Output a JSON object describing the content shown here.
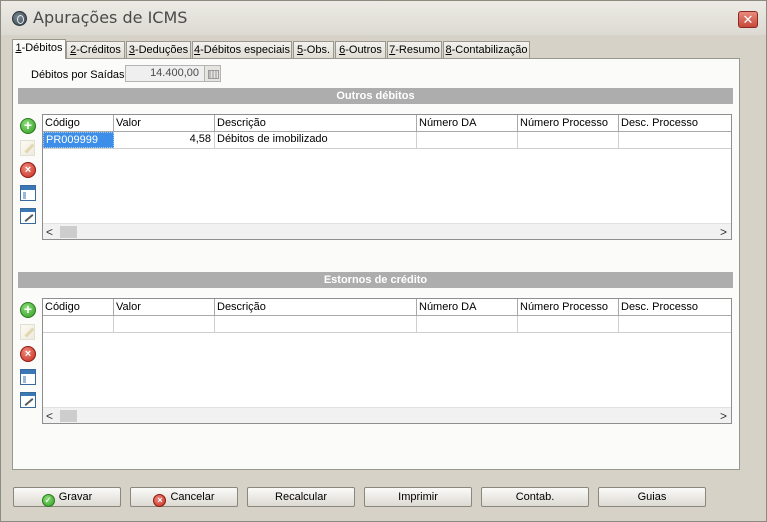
{
  "window": {
    "title": "Apurações de ICMS",
    "close_glyph": "✕"
  },
  "tabs": [
    {
      "key": "1",
      "rest": "-Débitos",
      "active": true
    },
    {
      "key": "2",
      "rest": "-Créditos",
      "active": false
    },
    {
      "key": "3",
      "rest": "-Deduções",
      "active": false
    },
    {
      "key": "4",
      "rest": "-Débitos especiais",
      "active": false
    },
    {
      "key": "5",
      "rest": "-Obs.",
      "active": false
    },
    {
      "key": "6",
      "rest": "-Outros",
      "active": false
    },
    {
      "key": "7",
      "rest": "-Resumo",
      "active": false
    },
    {
      "key": "8",
      "rest": "-Contabilização",
      "active": false
    }
  ],
  "debitos_saidas": {
    "label": "Débitos por Saídas",
    "value": "14.400,00"
  },
  "columns": [
    "Código",
    "Valor",
    "Descrição",
    "Número DA",
    "Número Processo",
    "Desc. Processo"
  ],
  "outros_debitos": {
    "header": "Outros débitos",
    "rows": [
      {
        "codigo": "PR009999",
        "valor": "4,58",
        "descricao": "Débitos de imobilizado",
        "numero_da": "",
        "numero_processo": "",
        "desc_processo": ""
      }
    ]
  },
  "estornos_credito": {
    "header": "Estornos de crédito",
    "rows": [
      {
        "codigo": "",
        "valor": "",
        "descricao": "",
        "numero_da": "",
        "numero_processo": "",
        "desc_processo": ""
      }
    ]
  },
  "side_toolbar_icons": [
    "add-icon",
    "edit-icon",
    "delete-icon",
    "window-icon",
    "pencil-window-icon"
  ],
  "scroll": {
    "left": "<",
    "right": ">"
  },
  "buttons": {
    "gravar": "Gravar",
    "cancelar": "Cancelar",
    "recalcular": "Recalcular",
    "imprimir": "Imprimir",
    "contab": "Contab.",
    "guias": "Guias"
  },
  "icons": {
    "plus": "+",
    "times": "×",
    "check": "✓"
  },
  "colors": {
    "selection": "#3d8ee8",
    "section_header": "#adadad"
  }
}
